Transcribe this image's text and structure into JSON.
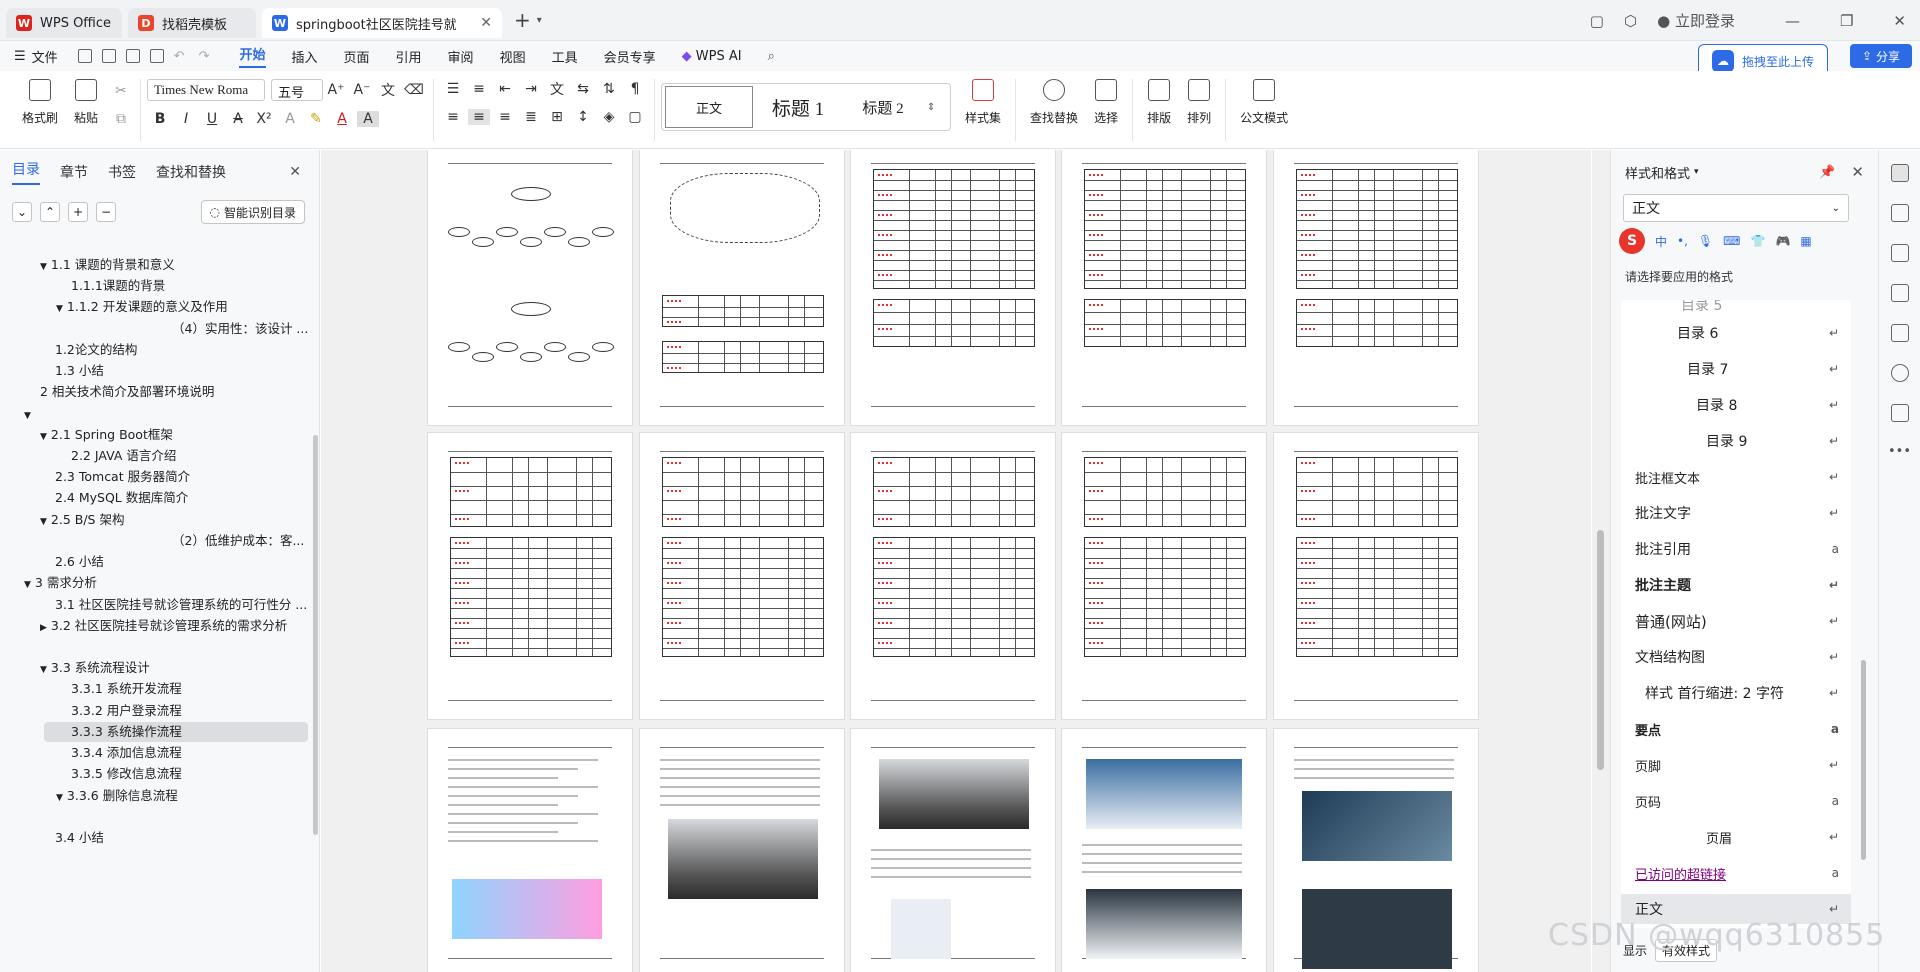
{
  "tabs": [
    {
      "label": "WPS Office",
      "color": "#d9251c"
    },
    {
      "label": "找稻壳模板",
      "color": "#e8452b"
    },
    {
      "label": "springboot社区医院挂号就诊",
      "color": "#2d6be6"
    }
  ],
  "login_label": "立即登录",
  "menu": {
    "file": "文件",
    "items": [
      "开始",
      "插入",
      "页面",
      "引用",
      "审阅",
      "视图",
      "工具",
      "会员专享"
    ],
    "wps_ai": "WPS AI",
    "upload_label": "拖拽至此上传",
    "share_label": "分享"
  },
  "ribbon": {
    "format_painter": "格式刷",
    "paste": "粘贴",
    "font_name": "Times New Roma",
    "font_size": "五号",
    "styles": [
      "正文",
      "标题 1",
      "标题 2"
    ],
    "style_set": "样式集",
    "find_replace": "查找替换",
    "select": "选择",
    "typeset": "排版",
    "arrange": "排列",
    "doc_mode": "公文模式"
  },
  "leftnav": {
    "tabs": [
      "目录",
      "章节",
      "书签",
      "查找和替换"
    ],
    "ai_toc": "智能识别目录",
    "toc": [
      "1.1 课题的背景和意义",
      "1.1.1课题的背景",
      "1.1.2 开发课题的意义及作用",
      "（4）实用性：该设计 ...",
      "1.2论文的结构",
      "1.3 小结",
      "2 相关技术简介及部署环境说明",
      "",
      "2.1 Spring Boot框架",
      "2.2 JAVA 语言介绍",
      "2.3 Tomcat 服务器简介",
      "2.4 MySQL 数据库简介",
      "2.5 B/S 架构",
      "（2）低维护成本：客...",
      "2.6 小结",
      "3 需求分析",
      "3.1 社区医院挂号就诊管理系统的可行性分 ...",
      "3.2 社区医院挂号就诊管理系统的需求分析",
      "3.3 系统流程设计",
      "3.3.1 系统开发流程",
      "3.3.2 用户登录流程",
      "3.3.3 系统操作流程",
      "3.3.4 添加信息流程",
      "3.3.5 修改信息流程",
      "3.3.6 删除信息流程",
      "3.4 小结"
    ]
  },
  "rightpanel": {
    "title": "样式和格式",
    "current_style": "正文",
    "ime_char": "S",
    "ime_mode": "中",
    "apply_label": "请选择要应用的格式",
    "styles": [
      "目录 6",
      "目录 7",
      "目录 8",
      "目录 9",
      "批注框文本",
      "批注文字",
      "批注引用",
      "批注主题",
      "普通(网站)",
      "文档结构图",
      "样式 首行缩进:  2 字符",
      "要点",
      "页脚",
      "页码",
      "页眉",
      "已访问的超链接",
      "正文"
    ],
    "show_label": "显示",
    "show_value": "有效样式"
  },
  "watermark": "CSDN @wqq6310855"
}
